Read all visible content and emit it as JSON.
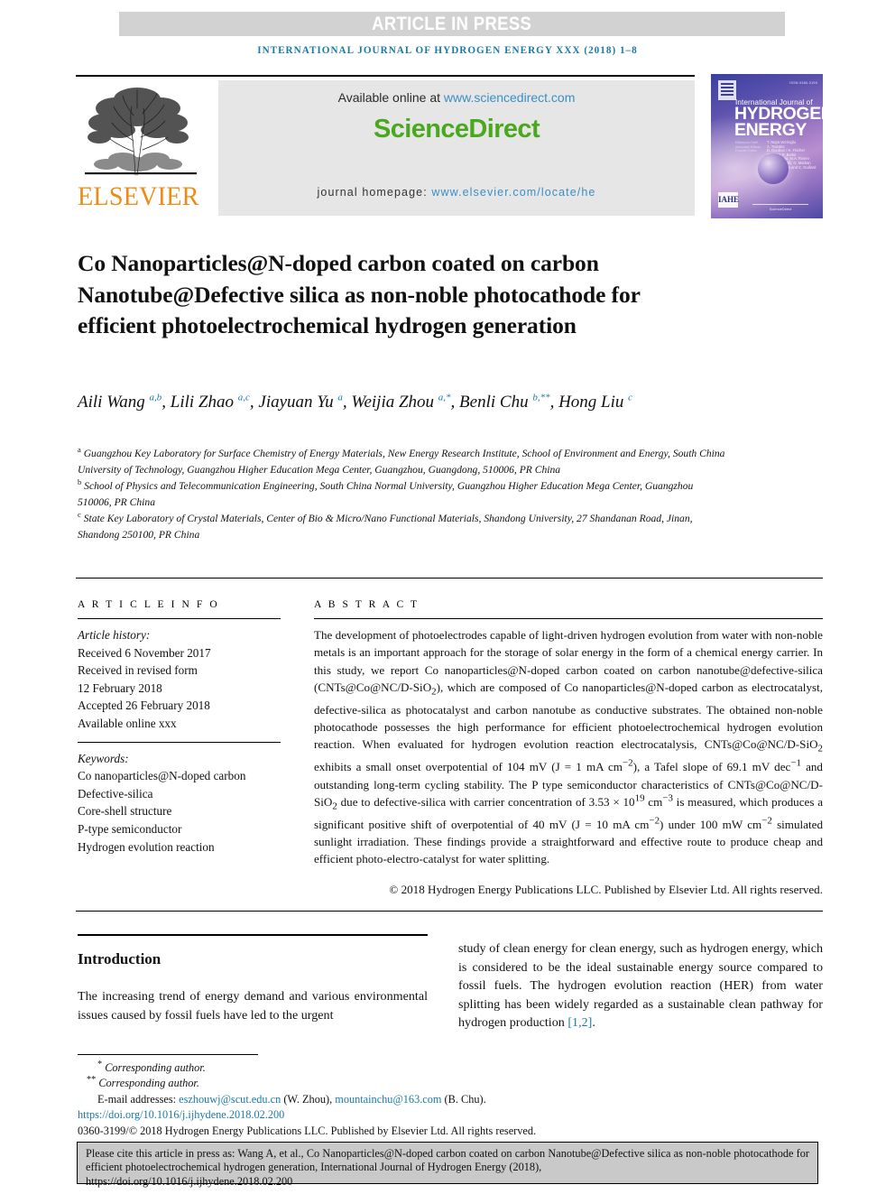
{
  "banner": {
    "article_in_press": "ARTICLE IN PRESS"
  },
  "running_head": "INTERNATIONAL JOURNAL OF HYDROGEN ENERGY XXX (2018) 1–8",
  "masthead": {
    "publisher_name": "ELSEVIER",
    "available_online_prefix": "Available online at ",
    "available_online_url": "www.sciencedirect.com",
    "sciencedirect_logo": "ScienceDirect",
    "homepage_prefix": "journal homepage: ",
    "homepage_url": "www.elsevier.com/locate/he"
  },
  "cover": {
    "issn": "ISSN 0360-3199",
    "line_small": "International Journal of",
    "line_big_1": "HYDROGEN",
    "line_big_2": "ENERGY",
    "editors_label": "Editors-in-Chief\nAssociate Editors\nFounder Editor",
    "editor_names": "T. Nejat Veziroglu\nA. Tsolakis\nD. Dunikov / H. Fischer\nH. Dong, F. Barbir\nM. Demirbas, M.A. Rosen\nM.G. Santarelli, G. Marban\nand A. Serban and C. Guillard",
    "ihe_badge": "IAHE",
    "foot_text": "ScienceDirect"
  },
  "title": "Co Nanoparticles@N-doped carbon coated on carbon Nanotube@Defective silica as non-noble photocathode for efficient photoelectrochemical hydrogen generation",
  "authors": [
    {
      "name": "Aili Wang",
      "sup": "a,b",
      "sep": ", "
    },
    {
      "name": "Lili Zhao",
      "sup": "a,c",
      "sep": ", "
    },
    {
      "name": "Jiayuan Yu",
      "sup": "a",
      "sep": ", "
    },
    {
      "name": "Weijia Zhou",
      "sup": "a,*",
      "sep": ", "
    },
    {
      "name": "Benli Chu",
      "sup": "b,**",
      "sep": ", "
    },
    {
      "name": "Hong Liu",
      "sup": "c",
      "sep": ""
    }
  ],
  "affiliations": [
    {
      "mark": "a",
      "text": "Guangzhou Key Laboratory for Surface Chemistry of Energy Materials, New Energy Research Institute, School of Environment and Energy, South China University of Technology, Guangzhou Higher Education Mega Center, Guangzhou, Guangdong, 510006, PR China"
    },
    {
      "mark": "b",
      "text": "School of Physics and Telecommunication Engineering, South China Normal University, Guangzhou Higher Education Mega Center, Guangzhou 510006, PR China"
    },
    {
      "mark": "c",
      "text": "State Key Laboratory of Crystal Materials, Center of Bio & Micro/Nano Functional Materials, Shandong University, 27 Shandanan Road, Jinan, Shandong 250100, PR China"
    }
  ],
  "article_info": {
    "heading": "A R T I C L E   I N F O",
    "history_label": "Article history:",
    "history": [
      "Received 6 November 2017",
      "Received in revised form",
      "12 February 2018",
      "Accepted 26 February 2018",
      "Available online xxx"
    ],
    "keywords_label": "Keywords:",
    "keywords": [
      "Co nanoparticles@N-doped carbon",
      "Defective-silica",
      "Core-shell structure",
      "P-type semiconductor",
      "Hydrogen evolution reaction"
    ]
  },
  "abstract": {
    "heading": "A B S T R A C T",
    "copyright": "© 2018 Hydrogen Energy Publications LLC. Published by Elsevier Ltd. All rights reserved."
  },
  "introduction": {
    "heading": "Introduction",
    "left_paragraph": "The increasing trend of energy demand and various environmental issues caused by fossil fuels have led to the urgent",
    "right_paragraph_pre": "study of clean energy for clean energy, such as hydrogen energy, which is considered to be the ideal sustainable energy source compared to fossil fuels. The hydrogen evolution reaction (HER) from water splitting has been widely regarded as a sustainable clean pathway for hydrogen production ",
    "right_paragraph_ref": "[1,2]",
    "right_paragraph_post": "."
  },
  "footnotes": {
    "corresponding_1": "Corresponding author.",
    "corresponding_2": "Corresponding author.",
    "email_label": "E-mail addresses: ",
    "email_1": "eszhouwj@scut.edu.cn",
    "email_1_owner": " (W. Zhou), ",
    "email_2": "mountainchu@163.com",
    "email_2_owner": " (B. Chu).",
    "doi": "https://doi.org/10.1016/j.ijhydene.2018.02.200",
    "issn_copyright": "0360-3199/© 2018 Hydrogen Energy Publications LLC. Published by Elsevier Ltd. All rights reserved."
  },
  "cite_box": {
    "line1": "Please cite this article in press as: Wang A, et al., Co Nanoparticles@N-doped carbon coated on carbon Nanotube@Defective silica as non-noble photocathode for efficient photoelectrochemical hydrogen generation, International Journal of Hydrogen Energy (2018),",
    "line2": "https://doi.org/10.1016/j.ijhydene.2018.02.200"
  },
  "colors": {
    "link": "#1a7aa8",
    "elsevier_orange": "#ec8b16",
    "sciencedirect_green": "#4aa81f",
    "banner_gray": "#d2d2d2",
    "cite_box_gray": "#c9c9c9"
  }
}
